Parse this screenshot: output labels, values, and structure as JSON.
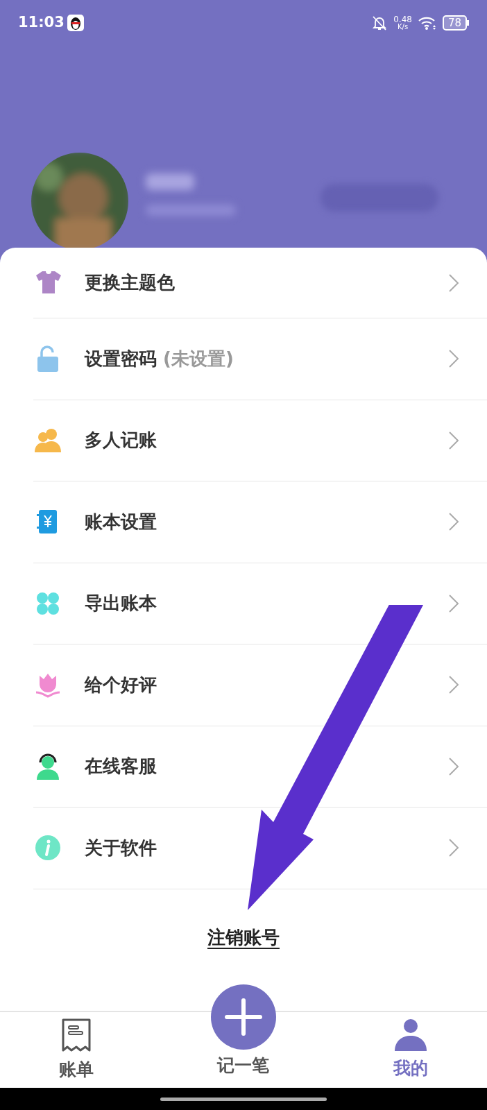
{
  "status_bar": {
    "time": "11:03",
    "net_speed": "0.48",
    "net_unit": "K/s",
    "battery": "78"
  },
  "menu": [
    {
      "label": "更换主题色",
      "kind": "shirt",
      "color": "#ad85c6"
    },
    {
      "label": "设置密码",
      "note": "(未设置)",
      "kind": "lock",
      "color": "#8dc4ec"
    },
    {
      "label": "多人记账",
      "kind": "people",
      "color": "#f6b84b"
    },
    {
      "label": "账本设置",
      "kind": "book",
      "color": "#1f9be0"
    },
    {
      "label": "导出账本",
      "kind": "clover",
      "color": "#5ee0e0"
    },
    {
      "label": "给个好评",
      "kind": "flower",
      "color": "#f08ad0"
    },
    {
      "label": "在线客服",
      "kind": "agent",
      "color": "#3ed98d"
    },
    {
      "label": "关于软件",
      "kind": "info",
      "color": "#6ee6c6"
    }
  ],
  "logout": "注销账号",
  "tabs": [
    {
      "label": "账单",
      "kind": "bill",
      "selected": false
    },
    {
      "label": "记一笔",
      "kind": "add",
      "selected": false
    },
    {
      "label": "我的",
      "kind": "me",
      "selected": true
    }
  ]
}
